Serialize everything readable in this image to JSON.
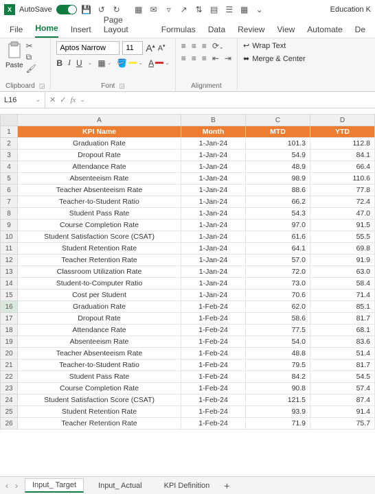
{
  "titlebar": {
    "autosave_label": "AutoSave",
    "filename": "Education K"
  },
  "ribbon_tabs": {
    "file": "File",
    "home": "Home",
    "insert": "Insert",
    "page_layout": "Page Layout",
    "formulas": "Formulas",
    "data": "Data",
    "review": "Review",
    "view": "View",
    "automate": "Automate",
    "developer": "De"
  },
  "ribbon": {
    "paste_label": "Paste",
    "font_name": "Aptos Narrow",
    "font_size": "11",
    "wrap_text": "Wrap Text",
    "merge_center": "Merge & Center",
    "group_clipboard": "Clipboard",
    "group_font": "Font",
    "group_alignment": "Alignment"
  },
  "formula_bar": {
    "namebox": "L16",
    "fx": "fx"
  },
  "columns": [
    "A",
    "B",
    "C",
    "D"
  ],
  "header_row": {
    "a": "KPI Name",
    "b": "Month",
    "c": "MTD",
    "d": "YTD"
  },
  "rows": [
    {
      "n": 2,
      "a": "Graduation Rate",
      "b": "1-Jan-24",
      "c": "101.3",
      "d": "112.8"
    },
    {
      "n": 3,
      "a": "Dropout Rate",
      "b": "1-Jan-24",
      "c": "54.9",
      "d": "84.1"
    },
    {
      "n": 4,
      "a": "Attendance Rate",
      "b": "1-Jan-24",
      "c": "48.9",
      "d": "66.4"
    },
    {
      "n": 5,
      "a": "Absenteeism Rate",
      "b": "1-Jan-24",
      "c": "98.9",
      "d": "110.6"
    },
    {
      "n": 6,
      "a": "Teacher Absenteeism Rate",
      "b": "1-Jan-24",
      "c": "88.6",
      "d": "77.8"
    },
    {
      "n": 7,
      "a": "Teacher-to-Student Ratio",
      "b": "1-Jan-24",
      "c": "66.2",
      "d": "72.4"
    },
    {
      "n": 8,
      "a": "Student Pass Rate",
      "b": "1-Jan-24",
      "c": "54.3",
      "d": "47.0"
    },
    {
      "n": 9,
      "a": "Course Completion Rate",
      "b": "1-Jan-24",
      "c": "97.0",
      "d": "91.5"
    },
    {
      "n": 10,
      "a": "Student Satisfaction Score (CSAT)",
      "b": "1-Jan-24",
      "c": "61.6",
      "d": "55.5"
    },
    {
      "n": 11,
      "a": "Student Retention Rate",
      "b": "1-Jan-24",
      "c": "64.1",
      "d": "69.8"
    },
    {
      "n": 12,
      "a": "Teacher Retention Rate",
      "b": "1-Jan-24",
      "c": "57.0",
      "d": "91.9"
    },
    {
      "n": 13,
      "a": "Classroom Utilization Rate",
      "b": "1-Jan-24",
      "c": "72.0",
      "d": "63.0"
    },
    {
      "n": 14,
      "a": "Student-to-Computer Ratio",
      "b": "1-Jan-24",
      "c": "73.0",
      "d": "58.4"
    },
    {
      "n": 15,
      "a": "Cost per Student",
      "b": "1-Jan-24",
      "c": "70.6",
      "d": "71.4"
    },
    {
      "n": 16,
      "a": "Graduation Rate",
      "b": "1-Feb-24",
      "c": "62.0",
      "d": "85.1"
    },
    {
      "n": 17,
      "a": "Dropout Rate",
      "b": "1-Feb-24",
      "c": "58.6",
      "d": "81.7"
    },
    {
      "n": 18,
      "a": "Attendance Rate",
      "b": "1-Feb-24",
      "c": "77.5",
      "d": "68.1"
    },
    {
      "n": 19,
      "a": "Absenteeism Rate",
      "b": "1-Feb-24",
      "c": "54.0",
      "d": "83.6"
    },
    {
      "n": 20,
      "a": "Teacher Absenteeism Rate",
      "b": "1-Feb-24",
      "c": "48.8",
      "d": "51.4"
    },
    {
      "n": 21,
      "a": "Teacher-to-Student Ratio",
      "b": "1-Feb-24",
      "c": "79.5",
      "d": "81.7"
    },
    {
      "n": 22,
      "a": "Student Pass Rate",
      "b": "1-Feb-24",
      "c": "84.2",
      "d": "54.5"
    },
    {
      "n": 23,
      "a": "Course Completion Rate",
      "b": "1-Feb-24",
      "c": "90.8",
      "d": "57.4"
    },
    {
      "n": 24,
      "a": "Student Satisfaction Score (CSAT)",
      "b": "1-Feb-24",
      "c": "121.5",
      "d": "87.4"
    },
    {
      "n": 25,
      "a": "Student Retention Rate",
      "b": "1-Feb-24",
      "c": "93.9",
      "d": "91.4"
    },
    {
      "n": 26,
      "a": "Teacher Retention Rate",
      "b": "1-Feb-24",
      "c": "71.9",
      "d": "75.7"
    }
  ],
  "sheets": {
    "input_target": "Input_ Target",
    "input_actual": "Input_ Actual",
    "kpi_definition": "KPI Definition"
  }
}
